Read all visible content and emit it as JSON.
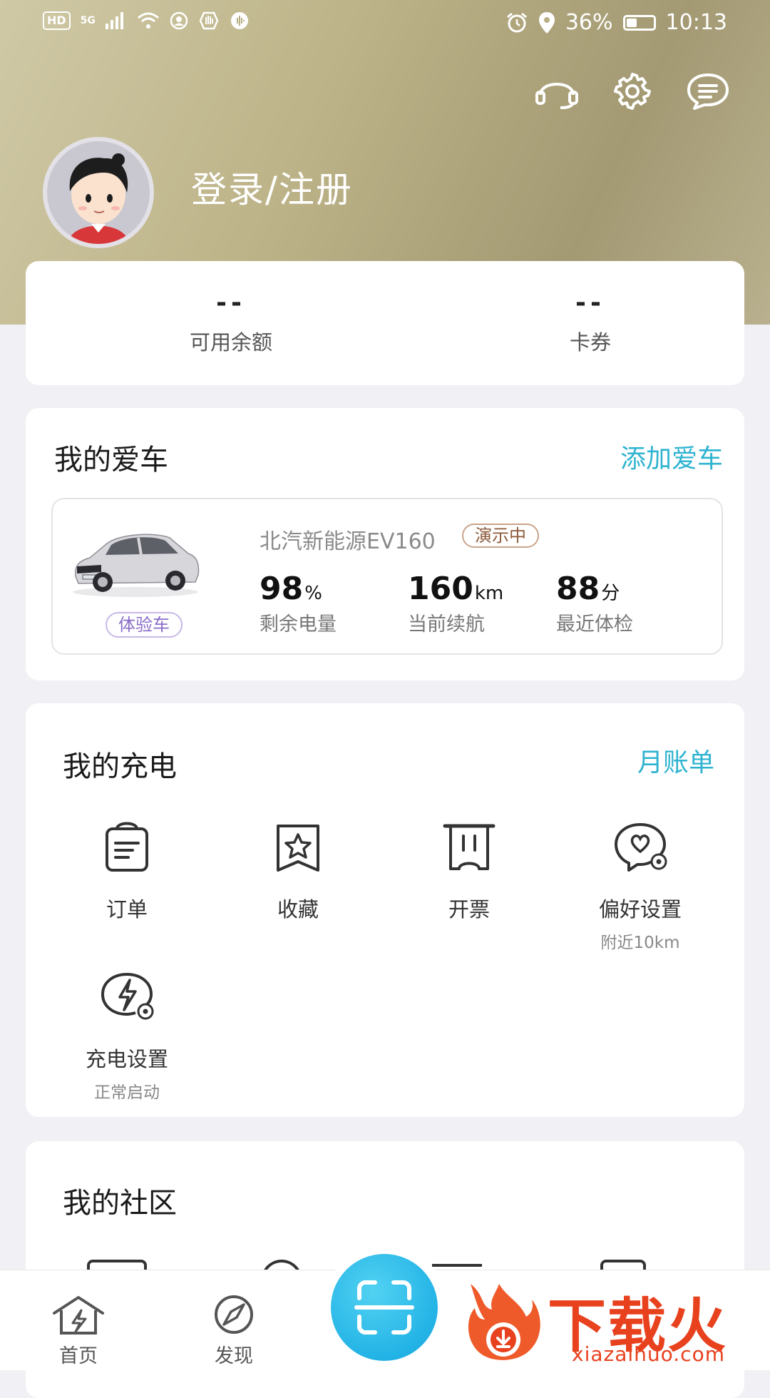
{
  "status_bar": {
    "left_chips": [
      "HD",
      "5G"
    ],
    "battery_percent": "36%",
    "battery_level": 0.36,
    "time": "10:13"
  },
  "header": {
    "icons": [
      "headset-icon",
      "gear-icon",
      "message-icon"
    ],
    "login_label": "登录/注册"
  },
  "balance": {
    "items": [
      {
        "value": "--",
        "label": "可用余额"
      },
      {
        "value": "--",
        "label": "卡券"
      }
    ]
  },
  "my_car": {
    "title": "我的爱车",
    "add_label": "添加爱车",
    "car_name": "北汽新能源EV160",
    "demo_badge": "演示中",
    "trial_badge": "体验车",
    "metrics": [
      {
        "value": "98",
        "unit": "%",
        "label": "剩余电量"
      },
      {
        "value": "160",
        "unit": "km",
        "label": "当前续航"
      },
      {
        "value": "88",
        "unit": "分",
        "label": "最近体检"
      }
    ]
  },
  "my_charging": {
    "title": "我的充电",
    "link_label": "月账单",
    "items": [
      {
        "label": "订单",
        "sub": "",
        "icon": "clipboard-icon"
      },
      {
        "label": "收藏",
        "sub": "",
        "icon": "star-icon"
      },
      {
        "label": "开票",
        "sub": "",
        "icon": "receipt-icon"
      },
      {
        "label": "偏好设置",
        "sub": "附近10km",
        "icon": "heart-settings-icon"
      },
      {
        "label": "充电设置",
        "sub": "正常启动",
        "icon": "bolt-settings-icon"
      }
    ]
  },
  "my_community": {
    "title": "我的社区"
  },
  "bottom_nav": {
    "items": [
      {
        "label": "首页",
        "icon": "home-bolt-icon"
      },
      {
        "label": "发现",
        "icon": "compass-icon"
      }
    ],
    "scan_icon": "scan-icon"
  },
  "watermark": {
    "text": "下载火",
    "url": "xiazaihuo.com"
  },
  "colors": {
    "accent": "#2eb3d0",
    "header_gold": "#b5ab82",
    "scan_blue": "#23b3e6",
    "watermark_red": "#e8411e"
  }
}
